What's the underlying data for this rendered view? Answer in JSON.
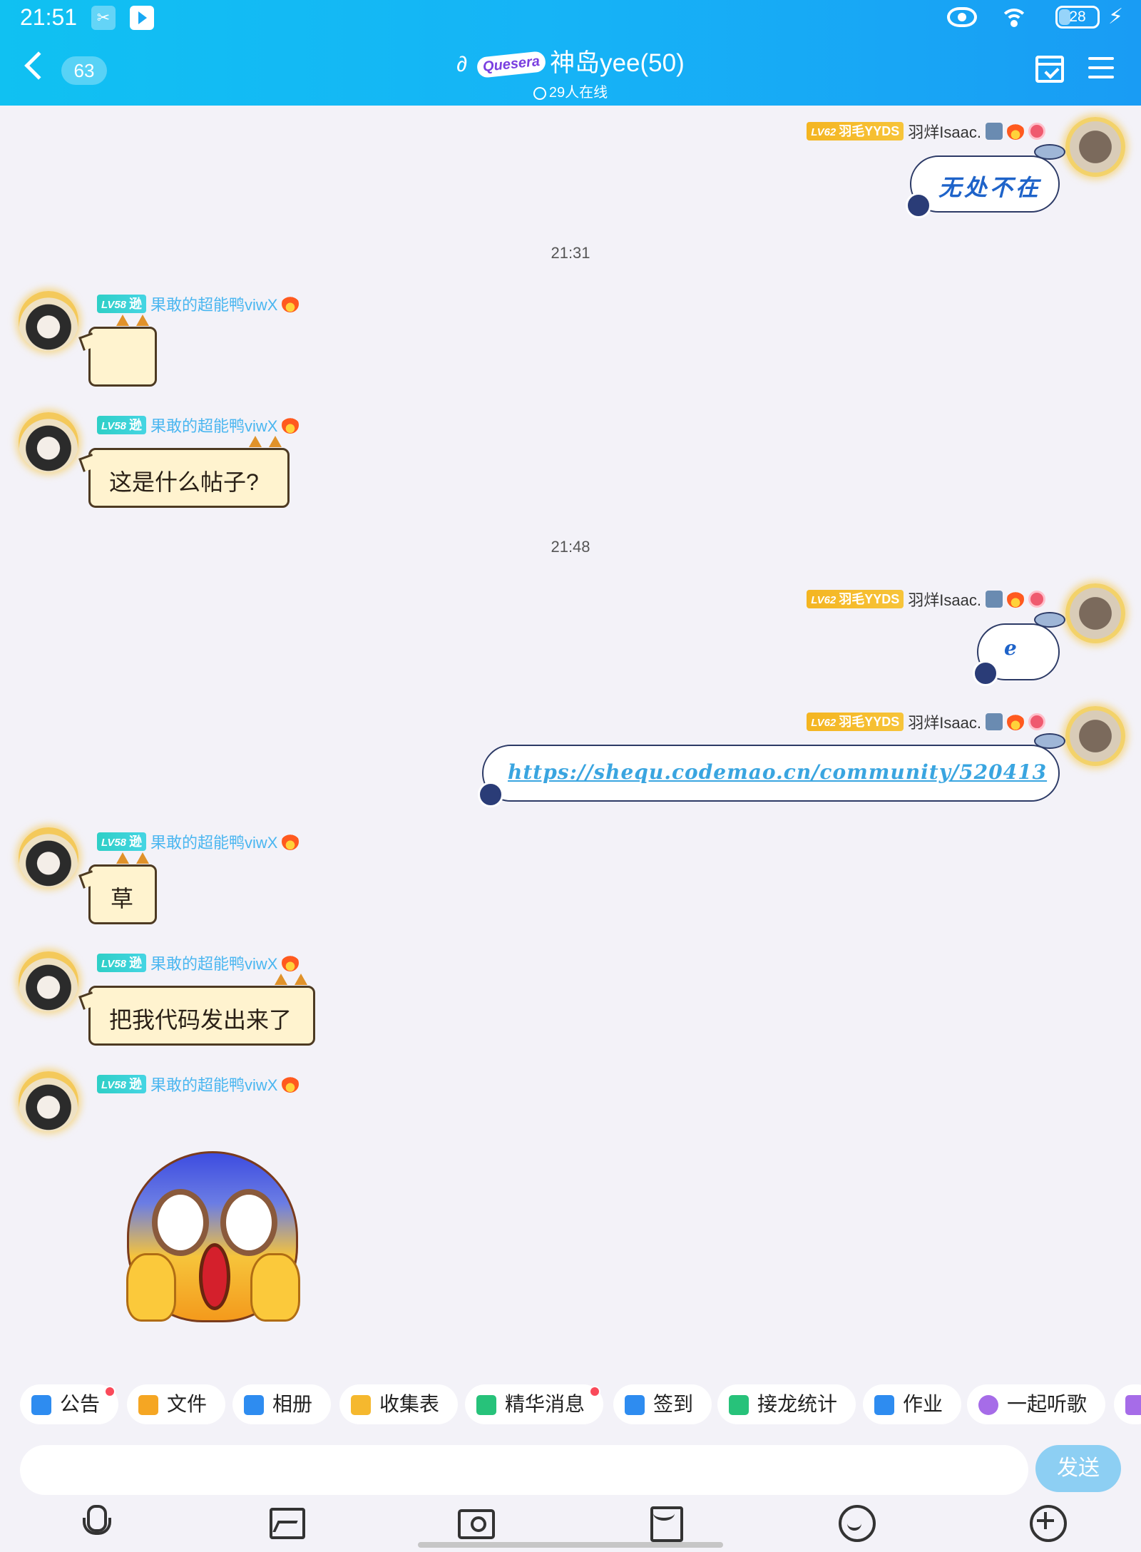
{
  "status_bar": {
    "time": "21:51",
    "battery": "28"
  },
  "header": {
    "unread_count": "63",
    "logo_text": "Quesera",
    "group_name": "神岛yee(50)",
    "online_text": "29人在线"
  },
  "users": {
    "right_user": {
      "level": "LV62",
      "title": "羽毛YYDS",
      "name": "羽烊Isaac."
    },
    "left_user": {
      "level": "LV58",
      "title": "逊",
      "name": "果敢的超能鸭viwX"
    }
  },
  "time_separators": [
    "21:31",
    "21:48"
  ],
  "messages": {
    "m1_text": "无处不在",
    "m3_text": "这是什么帖子?",
    "m4_text": "e",
    "m5_text": "https://shequ.codemao.cn/community/520413",
    "m6_text": "草",
    "m7_text": "把我代码发出来了"
  },
  "quick_actions": [
    {
      "label": "公告",
      "icon": "announcement-icon",
      "color": "#2e8cf0",
      "dot": true
    },
    {
      "label": "文件",
      "icon": "folder-icon",
      "color": "#f5a623",
      "dot": false
    },
    {
      "label": "相册",
      "icon": "album-icon",
      "color": "#2e8cf0",
      "dot": false
    },
    {
      "label": "收集表",
      "icon": "form-icon",
      "color": "#f5b82e",
      "dot": false
    },
    {
      "label": "精华消息",
      "icon": "highlight-icon",
      "color": "#27c27a",
      "dot": true
    },
    {
      "label": "签到",
      "icon": "checkin-icon",
      "color": "#2e8cf0",
      "dot": false
    },
    {
      "label": "接龙统计",
      "icon": "chain-icon",
      "color": "#27c27a",
      "dot": false
    },
    {
      "label": "作业",
      "icon": "homework-icon",
      "color": "#2e8cf0",
      "dot": false
    },
    {
      "label": "一起听歌",
      "icon": "music-icon",
      "color": "#a66ce8",
      "dot": false
    }
  ],
  "composer": {
    "send_label": "发送"
  },
  "bottom_bar": [
    "mic-icon",
    "image-icon",
    "camera-icon",
    "redpacket-icon",
    "emoji-icon",
    "plus-icon"
  ],
  "colors": {
    "header_start": "#10c1f2",
    "header_end": "#199cf4",
    "send_button": "#8dcff3"
  }
}
